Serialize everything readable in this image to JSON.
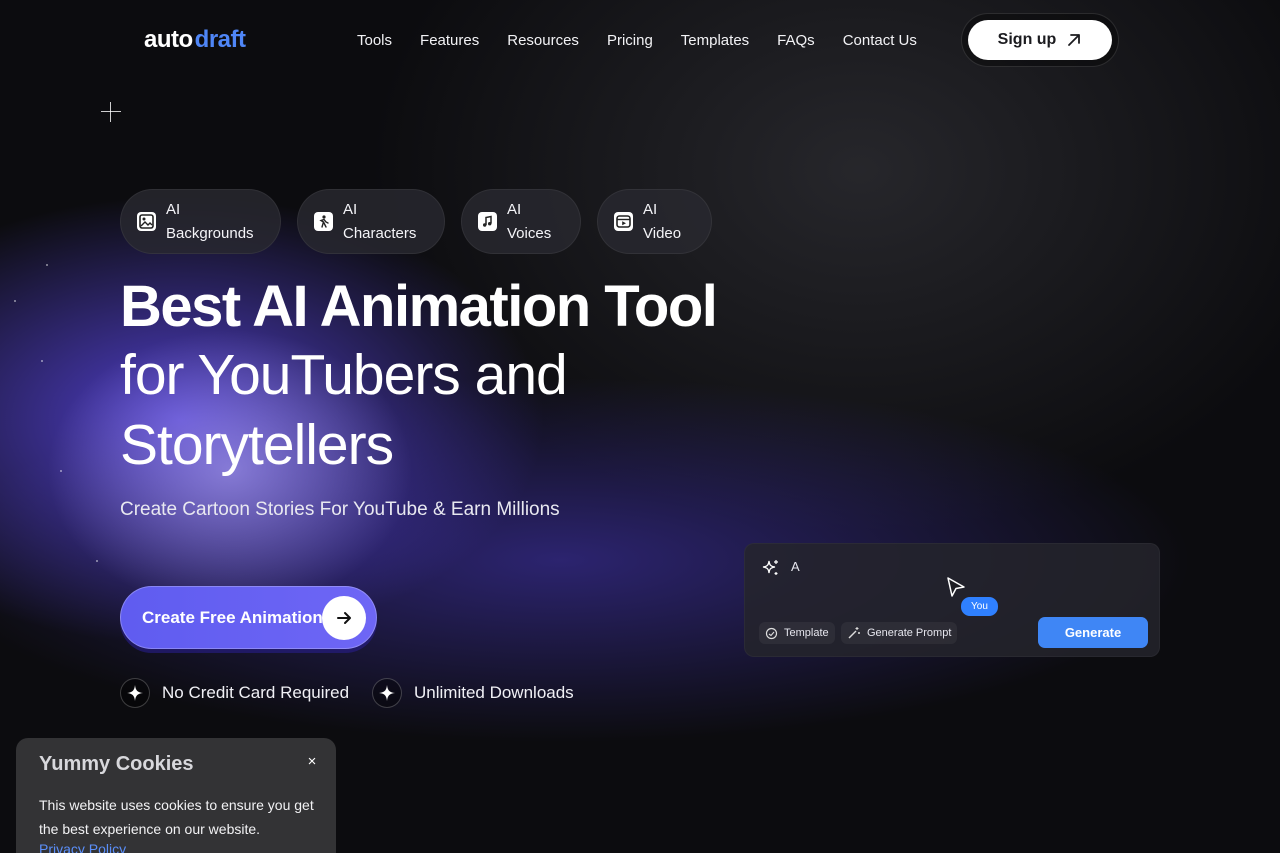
{
  "brand": {
    "logo_part1": "auto",
    "logo_part2": "draft"
  },
  "nav": {
    "items": [
      {
        "label": "Tools"
      },
      {
        "label": "Features"
      },
      {
        "label": "Resources"
      },
      {
        "label": "Pricing"
      },
      {
        "label": "Templates"
      },
      {
        "label": "FAQs"
      },
      {
        "label": "Contact Us"
      }
    ],
    "signup_label": "Sign up"
  },
  "chips": [
    {
      "line1": "AI",
      "line2": "Backgrounds",
      "icon": "image-icon"
    },
    {
      "line1": "AI",
      "line2": "Characters",
      "icon": "character-icon"
    },
    {
      "line1": "AI",
      "line2": "Voices",
      "icon": "music-note-icon"
    },
    {
      "line1": "AI",
      "line2": "Video",
      "icon": "video-icon"
    }
  ],
  "hero": {
    "title": "Best AI Animation Tool",
    "subtitle": "for YouTubers and Storytellers",
    "tagline": "Create Cartoon Stories For YouTube & Earn Millions",
    "cta_label": "Create Free Animations",
    "perks": [
      "No Credit Card Required",
      "Unlimited Downloads"
    ]
  },
  "demo": {
    "typed_text": "A",
    "cursor_label": "You",
    "template_label": "Template",
    "generate_prompt_label": "Generate Prompt",
    "generate_label": "Generate"
  },
  "cookie": {
    "title": "Yummy Cookies",
    "close_label": "×",
    "body": "This website uses cookies to ensure you get the best experience on our website.",
    "link": "Privacy Policy"
  },
  "colors": {
    "accent_blue": "#4f86f7",
    "cta_purple": "#6661f2",
    "generate_blue": "#3f86f5"
  }
}
